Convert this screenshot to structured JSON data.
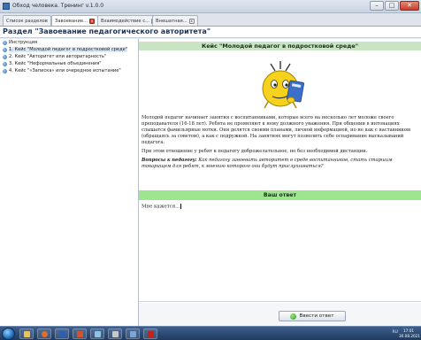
{
  "window": {
    "title": "Обход человека. Тренинг v.1.0.0"
  },
  "tabs": [
    {
      "label": "Список разделов",
      "closable": false,
      "active": false
    },
    {
      "label": "Завоевание...",
      "closable": true,
      "active": true
    },
    {
      "label": "Взаимодействие с...",
      "closable": true,
      "active": false
    },
    {
      "label": "Внешатная...",
      "closable": true,
      "active": false
    }
  ],
  "section": {
    "title": "Раздел \"Завоевание педагогического авторитета\""
  },
  "nav": {
    "items": [
      {
        "label": "Инструкция",
        "selected": false
      },
      {
        "label": "1. Кейс \"Молодой педагог в подростковой среде\"",
        "selected": true
      },
      {
        "label": "2. Кейс \"Авторитет или авторитарность\"",
        "selected": false
      },
      {
        "label": "3. Кейс \"Неформальные объединения\"",
        "selected": false
      },
      {
        "label": "4. Кейс \"«Записка» или очередное испытание\"",
        "selected": false
      }
    ]
  },
  "case": {
    "title": "Кейс \"Молодой педагог в подростковой среде\"",
    "paragraph1": "Молодой педагог начинает занятия с воспитанниками, которые всего на несколько лет моложе своего преподавателя (16-18 лет). Ребята не проявляют к нему должного уважения. При общении в интонациях слышатся фамильярные нотки. Они делятся своими планами, личной информацией, но не как с наставником (обращаясь за советом), а как с подружкой. На занятиях могут позволить себе оспаривание высказываний педагога.",
    "paragraph2": "При этом отношение у ребят к педагогу доброжелательное, но без необходимой дистанции.",
    "question_label": "Вопросы к педагогу:",
    "question_text": "Как педагогу завоевать авторитет в среде воспитанников, стать старшим товарищем для ребят, к мнению которого они будут прислушиваться?"
  },
  "answer": {
    "header": "Ваш ответ",
    "value": "Мне кажется..."
  },
  "footer": {
    "submit_label": "Ввести ответ"
  },
  "taskbar": {
    "tray_text": "RU",
    "time": "17:01",
    "date": "30.08.2021"
  },
  "colors": {
    "case_header_bg": "#c9e4c2",
    "answer_header_bg": "#9fe58f",
    "section_title": "#1a3355"
  }
}
